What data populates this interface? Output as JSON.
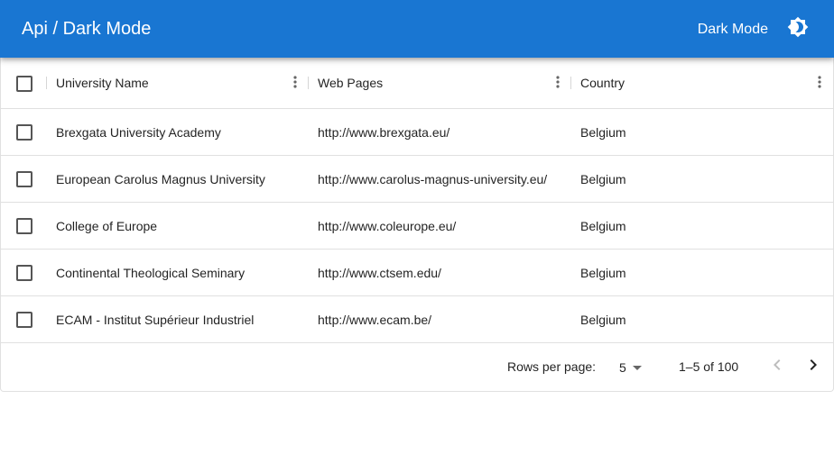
{
  "appbar": {
    "title": "Api / Dark Mode",
    "mode_label": "Dark Mode",
    "mode_icon": "brightness-icon",
    "color": "#1976d2"
  },
  "table": {
    "columns": [
      {
        "label": "University Name"
      },
      {
        "label": "Web Pages"
      },
      {
        "label": "Country"
      }
    ],
    "rows": [
      {
        "name": "Brexgata University Academy",
        "web": "http://www.brexgata.eu/",
        "country": "Belgium"
      },
      {
        "name": "European Carolus Magnus University",
        "web": "http://www.carolus-magnus-university.eu/",
        "country": "Belgium"
      },
      {
        "name": "College of Europe",
        "web": "http://www.coleurope.eu/",
        "country": "Belgium"
      },
      {
        "name": "Continental Theological Seminary",
        "web": "http://www.ctsem.edu/",
        "country": "Belgium"
      },
      {
        "name": "ECAM - Institut Supérieur Industriel",
        "web": "http://www.ecam.be/",
        "country": "Belgium"
      }
    ]
  },
  "pagination": {
    "rows_per_page_label": "Rows per page:",
    "rows_per_page_value": "5",
    "range": "1–5 of 100",
    "prev_icon": "chevron-left-icon",
    "next_icon": "chevron-right-icon"
  }
}
